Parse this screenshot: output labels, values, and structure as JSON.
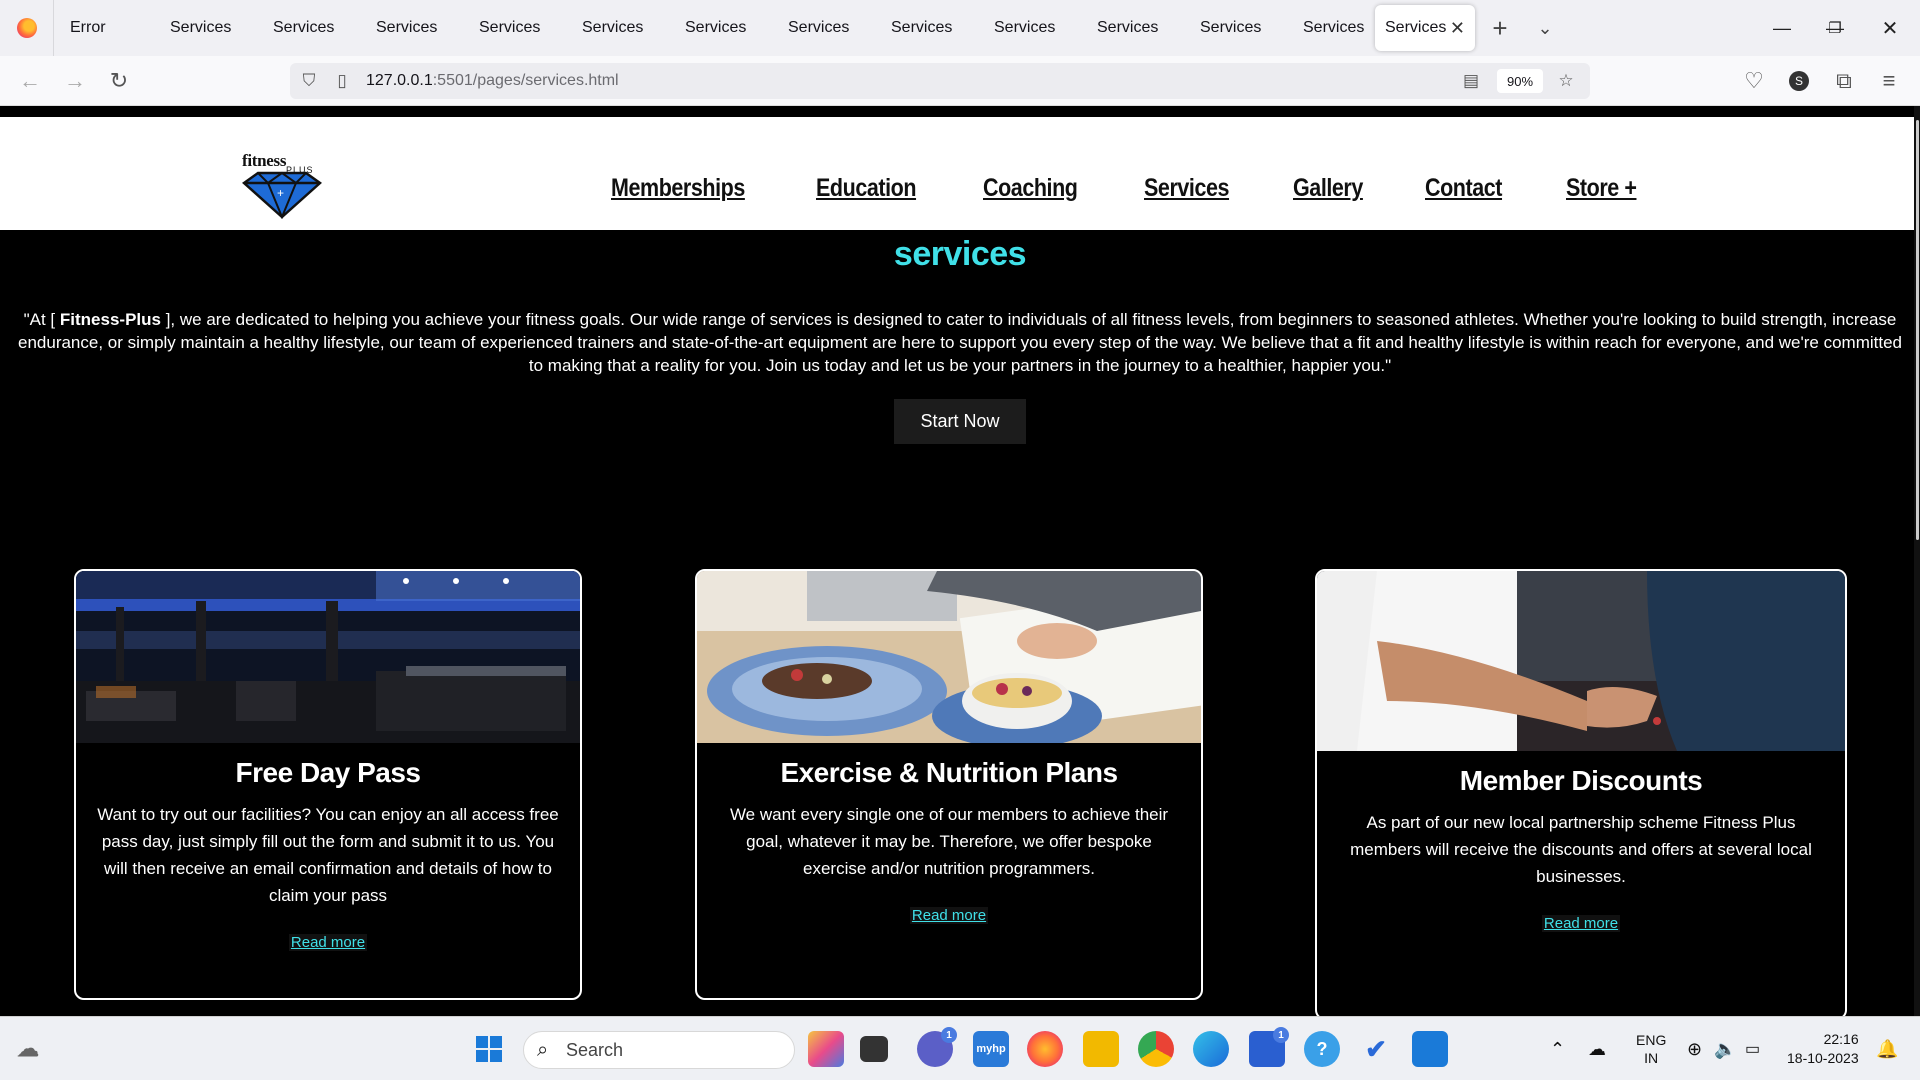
{
  "browser": {
    "tabs": [
      "Error",
      "Services",
      "Services",
      "Services",
      "Services",
      "Services",
      "Services",
      "Services",
      "Services",
      "Services",
      "Services",
      "Services",
      "Services",
      "Services"
    ],
    "active_tab": "Services",
    "url_host": "127.0.0.1",
    "url_path": ":5501/pages/services.html",
    "zoom": "90%"
  },
  "site": {
    "logo_text": "fitness",
    "logo_sub": "PLUS",
    "nav": [
      "Memberships",
      "Education",
      "Coaching",
      "Services",
      "Gallery",
      "Contact",
      "Store +"
    ],
    "hero": {
      "title": "services",
      "text_before": "\"At [ ",
      "brand": "Fitness-Plus",
      "text_after": " ], we are dedicated to helping you achieve your fitness goals. Our wide range of services is designed to cater to individuals of all fitness levels, from beginners to seasoned athletes. Whether you're looking to build strength, increase endurance, or simply maintain a healthy lifestyle, our team of experienced trainers and state-of-the-art equipment are here to support you every step of the way. We believe that a fit and healthy lifestyle is within reach for everyone, and we're committed to making that a reality for you. Join us today and let us be your partners in the journey to a healthier, happier you.\"",
      "button": "Start Now"
    },
    "cards": [
      {
        "title": "Free Day Pass",
        "text": "Want to try out our facilities? You can enjoy an all access free pass day, just simply fill out the form and submit it to us. You will then receive an email confirmation and details of how to claim your pass",
        "link": "Read more"
      },
      {
        "title": "Exercise & Nutrition Plans",
        "text": "We want every single one of our members to achieve their goal, whatever it may be. Therefore, we offer bespoke exercise and/or nutrition programmers.",
        "link": "Read more"
      },
      {
        "title": "Member Discounts",
        "text": "As part of our new local partnership scheme Fitness Plus members will receive the discounts and offers at several local businesses.",
        "link": "Read more"
      }
    ]
  },
  "taskbar": {
    "search_placeholder": "Search",
    "lang_top": "ENG",
    "lang_bottom": "IN",
    "time": "22:16",
    "date": "18-10-2023",
    "badge_chat": "1",
    "badge_store": "1"
  },
  "colors": {
    "accent": "#40e0e8",
    "page_bg": "#000000",
    "header_bg": "#ffffff"
  }
}
